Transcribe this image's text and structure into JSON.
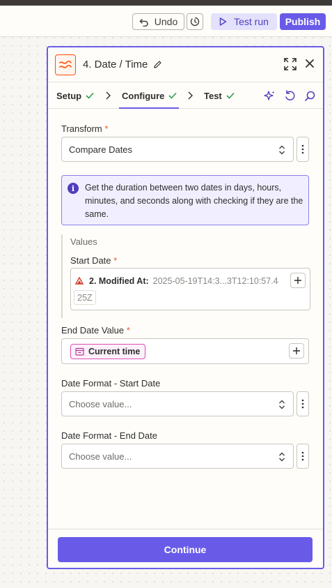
{
  "topbar": {
    "undo_label": "Undo",
    "test_run_label": "Test run",
    "publish_label": "Publish"
  },
  "panel": {
    "title": "4. Date / Time",
    "tabs": [
      {
        "label": "Setup",
        "status": "complete"
      },
      {
        "label": "Configure",
        "status": "complete",
        "active": true
      },
      {
        "label": "Test",
        "status": "complete"
      }
    ]
  },
  "form": {
    "transform_label": "Transform",
    "transform_value": "Compare Dates",
    "info_text": "Get the duration between two dates in days, hours, minutes, and seconds along with checking if they are the same.",
    "values_title": "Values",
    "start_date_label": "Start Date",
    "start_date_step": "2. Modified At:",
    "start_date_value": "2025-05-19T14:3...3T12:10:57.4",
    "start_date_value_wrap": "25Z",
    "end_date_label": "End Date Value",
    "end_date_pill": "Current time",
    "format_start_label": "Date Format - Start Date",
    "format_start_placeholder": "Choose value...",
    "format_end_label": "Date Format - End Date",
    "format_end_placeholder": "Choose value...",
    "required_mark": "*"
  },
  "footer": {
    "continue_label": "Continue"
  },
  "colors": {
    "accent": "#695be8",
    "app_icon": "#ff4f00",
    "success_check": "#2e9a4e",
    "required": "#e8572c"
  }
}
